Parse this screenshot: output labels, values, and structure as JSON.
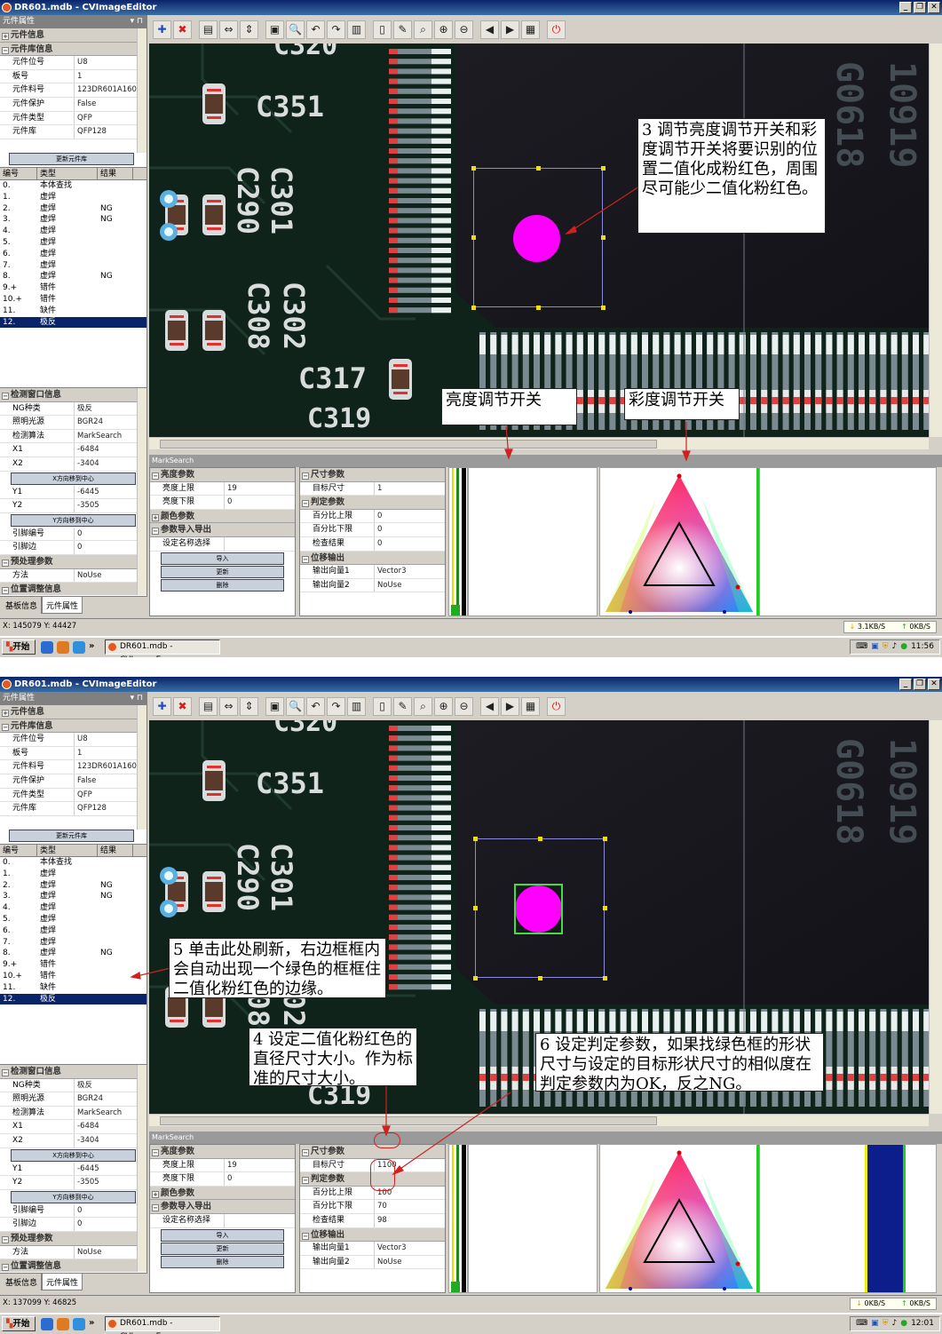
{
  "app": {
    "title": "DR601.mdb - CVImageEditor",
    "win_buttons": [
      "_",
      "❐",
      "✕"
    ]
  },
  "left": {
    "header": "元件属性",
    "sections": {
      "comp_info": "元件信息",
      "lib_info": "元件库信息",
      "detect": "检测窗口信息",
      "preprocess": "预处理参数",
      "posadj": "位置调整信息"
    },
    "props": [
      {
        "k": "元件位号",
        "v": "U8"
      },
      {
        "k": "板号",
        "v": "1"
      },
      {
        "k": "元件料号",
        "v": "123DR601A1600"
      },
      {
        "k": "元件保护",
        "v": "False"
      },
      {
        "k": "元件类型",
        "v": "QFP"
      },
      {
        "k": "元件库",
        "v": "QFP128"
      }
    ],
    "update_btn": "更新元件库",
    "list_headers": [
      "编号",
      "类型",
      "结果"
    ],
    "list": [
      [
        "0.",
        "本体查找",
        ""
      ],
      [
        "1.",
        "虚焊",
        ""
      ],
      [
        "2.",
        "虚焊",
        "NG"
      ],
      [
        "3.",
        "虚焊",
        "NG"
      ],
      [
        "4.",
        "虚焊",
        ""
      ],
      [
        "5.",
        "虚焊",
        ""
      ],
      [
        "6.",
        "虚焊",
        ""
      ],
      [
        "7.",
        "虚焊",
        ""
      ],
      [
        "8.",
        "虚焊",
        "NG"
      ],
      [
        "9.+",
        "错件",
        ""
      ],
      [
        "10.+",
        "错件",
        ""
      ],
      [
        "11.",
        "缺件",
        ""
      ],
      [
        "12.",
        "极反",
        ""
      ]
    ],
    "detect_rows_a": [
      {
        "k": "NG种类",
        "v": "极反"
      },
      {
        "k": "照明光源",
        "v": "BGR24"
      },
      {
        "k": "检测算法",
        "v": "MarkSearch"
      },
      {
        "k": "X1",
        "v": "-6484"
      },
      {
        "k": "X2",
        "v": "-3404"
      }
    ],
    "xcenter_btn": "X方向移到中心",
    "detect_rows_b": [
      {
        "k": "Y1",
        "v": "-6445"
      },
      {
        "k": "Y2",
        "v": "-3505"
      }
    ],
    "ycenter_btn": "Y方向移到中心",
    "detect_rows_c": [
      {
        "k": "引脚编号",
        "v": "0"
      },
      {
        "k": "引脚边",
        "v": "0"
      }
    ],
    "method": {
      "k": "方法",
      "v": "NoUse"
    },
    "tabs": [
      "基板信息",
      "元件属性"
    ]
  },
  "toolbar_icons": [
    "add-icon",
    "delete-icon",
    "copy-icon",
    "fit-width-icon",
    "fit-height-icon",
    "image-icon",
    "zoom-tool-icon",
    "undo-icon",
    "redo-icon",
    "book-icon",
    "page-icon",
    "open-icon",
    "zoom-icon",
    "zoom-in-icon",
    "zoom-out-icon",
    "arrow-left-icon",
    "arrow-right-icon",
    "notebook-icon",
    "stop-icon"
  ],
  "toolbar_glyphs": [
    "✚",
    "✖",
    "▤",
    "⇔",
    "⇕",
    "▣",
    "🔍",
    "↶",
    "↷",
    "▥",
    "▯",
    "✎",
    "⌕",
    "⊕",
    "⊖",
    "◀",
    "▶",
    "▦",
    "⏻"
  ],
  "image_labels": {
    "c320": "C320",
    "c351": "C351",
    "c301": "C301",
    "c290": "C290",
    "c302": "C302",
    "c308": "C308",
    "c317": "C317",
    "c319": "C319"
  },
  "marksearch": {
    "header": "MarkSearch",
    "brightness": "亮度参数",
    "upper_k": "亮度上限",
    "upper_v": "19",
    "lower_k": "亮度下限",
    "lower_v": "0",
    "color": "颜色参数",
    "import": "参数导入导出",
    "preset": "设定名称选择",
    "btn_import": "导入",
    "btn_update": "更新",
    "btn_delete": "删除",
    "size": "尺寸参数",
    "target": "目标尺寸",
    "judge": "判定参数",
    "pct_upper": "百分比上限",
    "pct_lower": "百分比下限",
    "check": "检查结果",
    "offset": "位移输出",
    "vec1": "输出向量1",
    "vec1_v": "Vector3",
    "vec2": "输出向量2",
    "vec2_v": "NoUse"
  },
  "screens": [
    {
      "target_v": "1",
      "pct_upper_v": "0",
      "pct_lower_v": "0",
      "check_v": "0",
      "coords": "X: 145079 Y: 44427",
      "net_down": "3.1KB/S",
      "net_up": "0KB/S",
      "clock": "11:56"
    },
    {
      "target_v": "1100",
      "pct_upper_v": "100",
      "pct_lower_v": "70",
      "check_v": "98",
      "coords": "X: 137099 Y: 46825",
      "net_down": "0KB/S",
      "net_up": "0KB/S",
      "clock": "12:01"
    }
  ],
  "taskbar": {
    "start": "开始",
    "item": "DR601.mdb - CVImageE...",
    "chevron": "»"
  },
  "callouts": {
    "c3": "3 调节亮度调节开关和彩度调节开关将要识别的位置二值化成粉红色，周围尽可能少二值化粉红色。",
    "brightness_switch": "亮度调节开关",
    "chroma_switch": "彩度调节开关",
    "c5": "5 单击此处刷新，右边框框内会自动出现一个绿色的框框住二值化粉红色的边缘。",
    "c4": "4 设定二值化粉红色的直径尺寸大小。作为标准的尺寸大小。",
    "c6": "6 设定判定参数，如果找绿色框的形状尺寸与设定的目标形状尺寸的相似度在判定参数内为OK，反之NG。"
  },
  "colors": {
    "pink": "#ff00ff",
    "green_box": "#44dd44",
    "annotation_red": "#d02020"
  }
}
